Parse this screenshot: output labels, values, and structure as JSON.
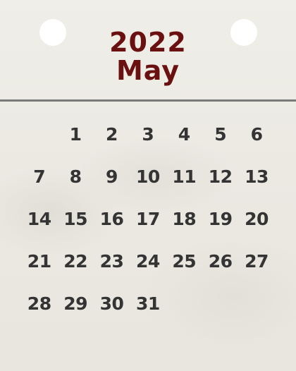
{
  "calendar": {
    "year": "2022",
    "month": "May",
    "leading_blank_days": 1,
    "days": [
      "1",
      "2",
      "3",
      "4",
      "5",
      "6",
      "7",
      "8",
      "9",
      "10",
      "11",
      "12",
      "13",
      "14",
      "15",
      "16",
      "17",
      "18",
      "19",
      "20",
      "21",
      "22",
      "23",
      "24",
      "25",
      "26",
      "27",
      "28",
      "29",
      "30",
      "31"
    ]
  },
  "colors": {
    "title": "#6b1010",
    "day_numbers": "#343434",
    "divider": "#7a7a78",
    "paper": "#ebe9e2",
    "holes": "#ffffff"
  }
}
